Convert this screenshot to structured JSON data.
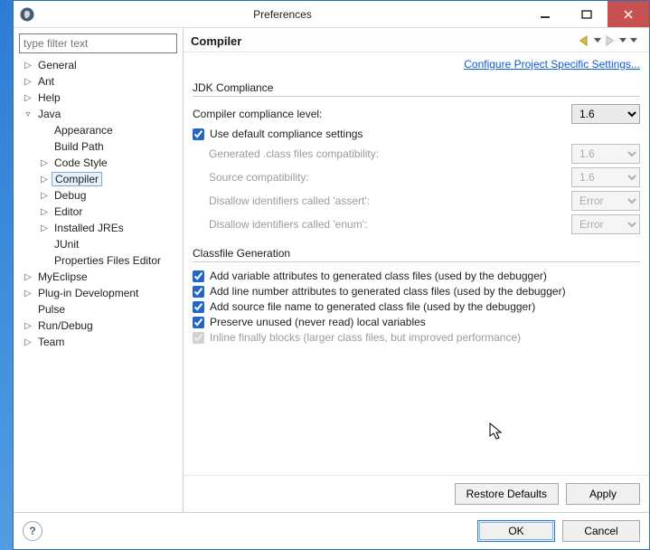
{
  "window": {
    "title": "Preferences"
  },
  "filter": {
    "placeholder": "type filter text"
  },
  "tree": [
    {
      "label": "General",
      "level": 0,
      "expander": "▷"
    },
    {
      "label": "Ant",
      "level": 0,
      "expander": "▷"
    },
    {
      "label": "Help",
      "level": 0,
      "expander": "▷"
    },
    {
      "label": "Java",
      "level": 0,
      "expander": "▿"
    },
    {
      "label": "Appearance",
      "level": 1,
      "expander": ""
    },
    {
      "label": "Build Path",
      "level": 1,
      "expander": ""
    },
    {
      "label": "Code Style",
      "level": 1,
      "expander": "▷"
    },
    {
      "label": "Compiler",
      "level": 1,
      "expander": "▷",
      "selected": true
    },
    {
      "label": "Debug",
      "level": 1,
      "expander": "▷"
    },
    {
      "label": "Editor",
      "level": 1,
      "expander": "▷"
    },
    {
      "label": "Installed JREs",
      "level": 1,
      "expander": "▷"
    },
    {
      "label": "JUnit",
      "level": 1,
      "expander": ""
    },
    {
      "label": "Properties Files Editor",
      "level": 1,
      "expander": ""
    },
    {
      "label": "MyEclipse",
      "level": 0,
      "expander": "▷"
    },
    {
      "label": "Plug-in Development",
      "level": 0,
      "expander": "▷"
    },
    {
      "label": "Pulse",
      "level": 0,
      "expander": ""
    },
    {
      "label": "Run/Debug",
      "level": 0,
      "expander": "▷"
    },
    {
      "label": "Team",
      "level": 0,
      "expander": "▷"
    }
  ],
  "page": {
    "title": "Compiler",
    "project_link": "Configure Project Specific Settings...",
    "jdk": {
      "heading": "JDK Compliance",
      "level_label": "Compiler compliance level:",
      "level_value": "1.6",
      "use_default_label": "Use default compliance settings",
      "use_default_checked": true,
      "rows": [
        {
          "label": "Generated .class files compatibility:",
          "value": "1.6"
        },
        {
          "label": "Source compatibility:",
          "value": "1.6"
        },
        {
          "label": "Disallow identifiers called 'assert':",
          "value": "Error"
        },
        {
          "label": "Disallow identifiers called 'enum':",
          "value": "Error"
        }
      ]
    },
    "classfile": {
      "heading": "Classfile Generation",
      "items": [
        {
          "label": "Add variable attributes to generated class files (used by the debugger)",
          "checked": true,
          "enabled": true
        },
        {
          "label": "Add line number attributes to generated class files (used by the debugger)",
          "checked": true,
          "enabled": true
        },
        {
          "label": "Add source file name to generated class file (used by the debugger)",
          "checked": true,
          "enabled": true
        },
        {
          "label": "Preserve unused (never read) local variables",
          "checked": true,
          "enabled": true
        },
        {
          "label": "Inline finally blocks (larger class files, but improved performance)",
          "checked": true,
          "enabled": false
        }
      ]
    }
  },
  "buttons": {
    "restore": "Restore Defaults",
    "apply": "Apply",
    "ok": "OK",
    "cancel": "Cancel",
    "help": "?"
  }
}
